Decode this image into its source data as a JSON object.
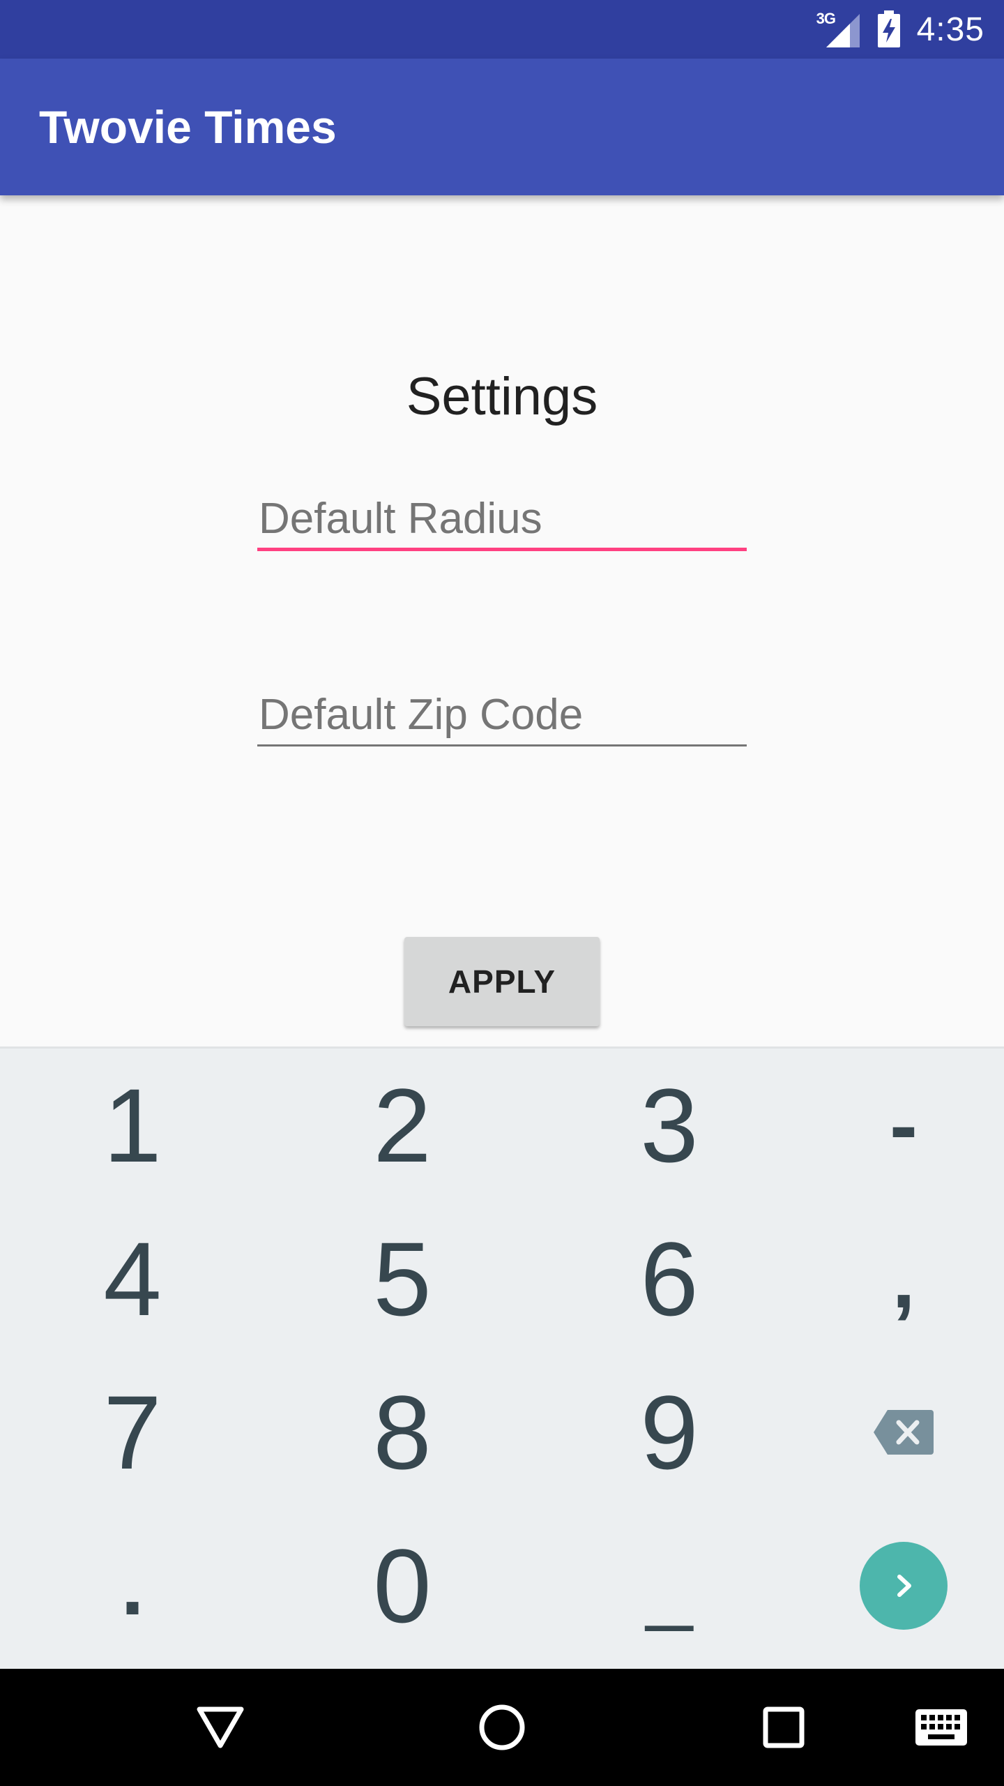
{
  "status_bar": {
    "network": "3G",
    "time": "4:35",
    "icons": [
      "signal-icon",
      "battery-charging-icon"
    ]
  },
  "app_bar": {
    "title": "Twovie Times"
  },
  "settings": {
    "heading": "Settings",
    "radius_field": {
      "placeholder": "Default Radius",
      "value": "",
      "focused": true
    },
    "zip_field": {
      "placeholder": "Default Zip Code",
      "value": ""
    },
    "apply_label": "APPLY"
  },
  "keyboard": {
    "rows": [
      [
        "1",
        "2",
        "3",
        "-"
      ],
      [
        "4",
        "5",
        "6",
        ","
      ],
      [
        "7",
        "8",
        "9",
        "backspace-icon"
      ],
      [
        ".",
        "0",
        "_",
        "next-icon"
      ]
    ],
    "key_color": "#37474F",
    "enter_color": "#4DB6AC"
  },
  "nav_bar": {
    "icons": [
      "back-icon",
      "home-icon",
      "recents-icon",
      "keyboard-switch-icon"
    ]
  },
  "colors": {
    "status_bar": "#303F9F",
    "app_bar": "#3F51B5",
    "accent": "#FF4081",
    "keyboard_bg": "#ECEFF1"
  }
}
